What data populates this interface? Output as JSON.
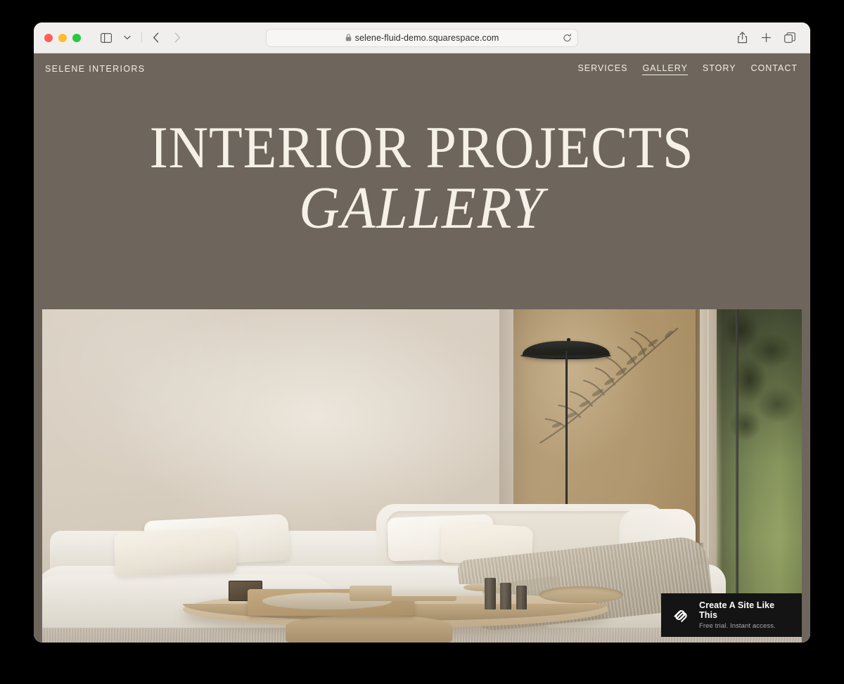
{
  "browser": {
    "window_controls": [
      "close",
      "minimize",
      "zoom"
    ],
    "sidebar_toggle_icon": "sidebar-icon",
    "dropdown_icon": "chevron-down-icon",
    "back_icon": "back-arrow-icon",
    "forward_icon": "forward-arrow-icon",
    "address": {
      "lock_icon": "lock-icon",
      "url": "selene-fluid-demo.squarespace.com",
      "reload_icon": "reload-icon"
    },
    "actions": {
      "share_icon": "share-icon",
      "new_tab_icon": "plus-icon",
      "tab_overview_icon": "tab-overview-icon"
    }
  },
  "site": {
    "logo": "SELENE INTERIORS",
    "nav": [
      {
        "label": "SERVICES",
        "active": false
      },
      {
        "label": "GALLERY",
        "active": true
      },
      {
        "label": "STORY",
        "active": false
      },
      {
        "label": "CONTACT",
        "active": false
      }
    ],
    "hero": {
      "line1": "INTERIOR PROJECTS",
      "line2": "GALLERY"
    },
    "photo": {
      "alt": "Minimalist living room with cream sectional sofa, oak coffee table and black floor lamp"
    }
  },
  "badge": {
    "logo_icon": "squarespace-logo-icon",
    "title": "Create A Site Like This",
    "subtitle": "Free trial. Instant access."
  },
  "colors": {
    "header_bg": "#6e665d",
    "hero_text": "#f6f1e8",
    "badge_bg": "#141414",
    "toolbar_bg": "#f0efee",
    "accent_wall": "#ae9369"
  }
}
